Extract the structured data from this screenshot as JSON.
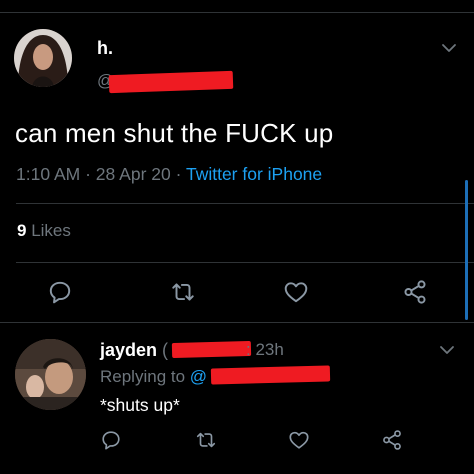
{
  "tweet": {
    "author_name": "h.",
    "handle_prefix": "@",
    "text": "can men shut the FUCK up",
    "time": "1:10 AM",
    "date": "28 Apr 20",
    "separator": "·",
    "source": "Twitter for iPhone",
    "likes_count": "9",
    "likes_label": "Likes"
  },
  "reply": {
    "author_name": "jayden",
    "handle_open": "(",
    "time_text": ": 23h",
    "replying_label": "Replying to",
    "replying_at": "@",
    "text": "*shuts up*"
  },
  "colors": {
    "background": "#000000",
    "secondary_text": "#6e767d",
    "link": "#1da1f2",
    "redaction": "#ef1b22"
  },
  "icons": [
    "chevron-down-icon",
    "reply-icon",
    "retweet-icon",
    "like-icon",
    "share-icon"
  ]
}
